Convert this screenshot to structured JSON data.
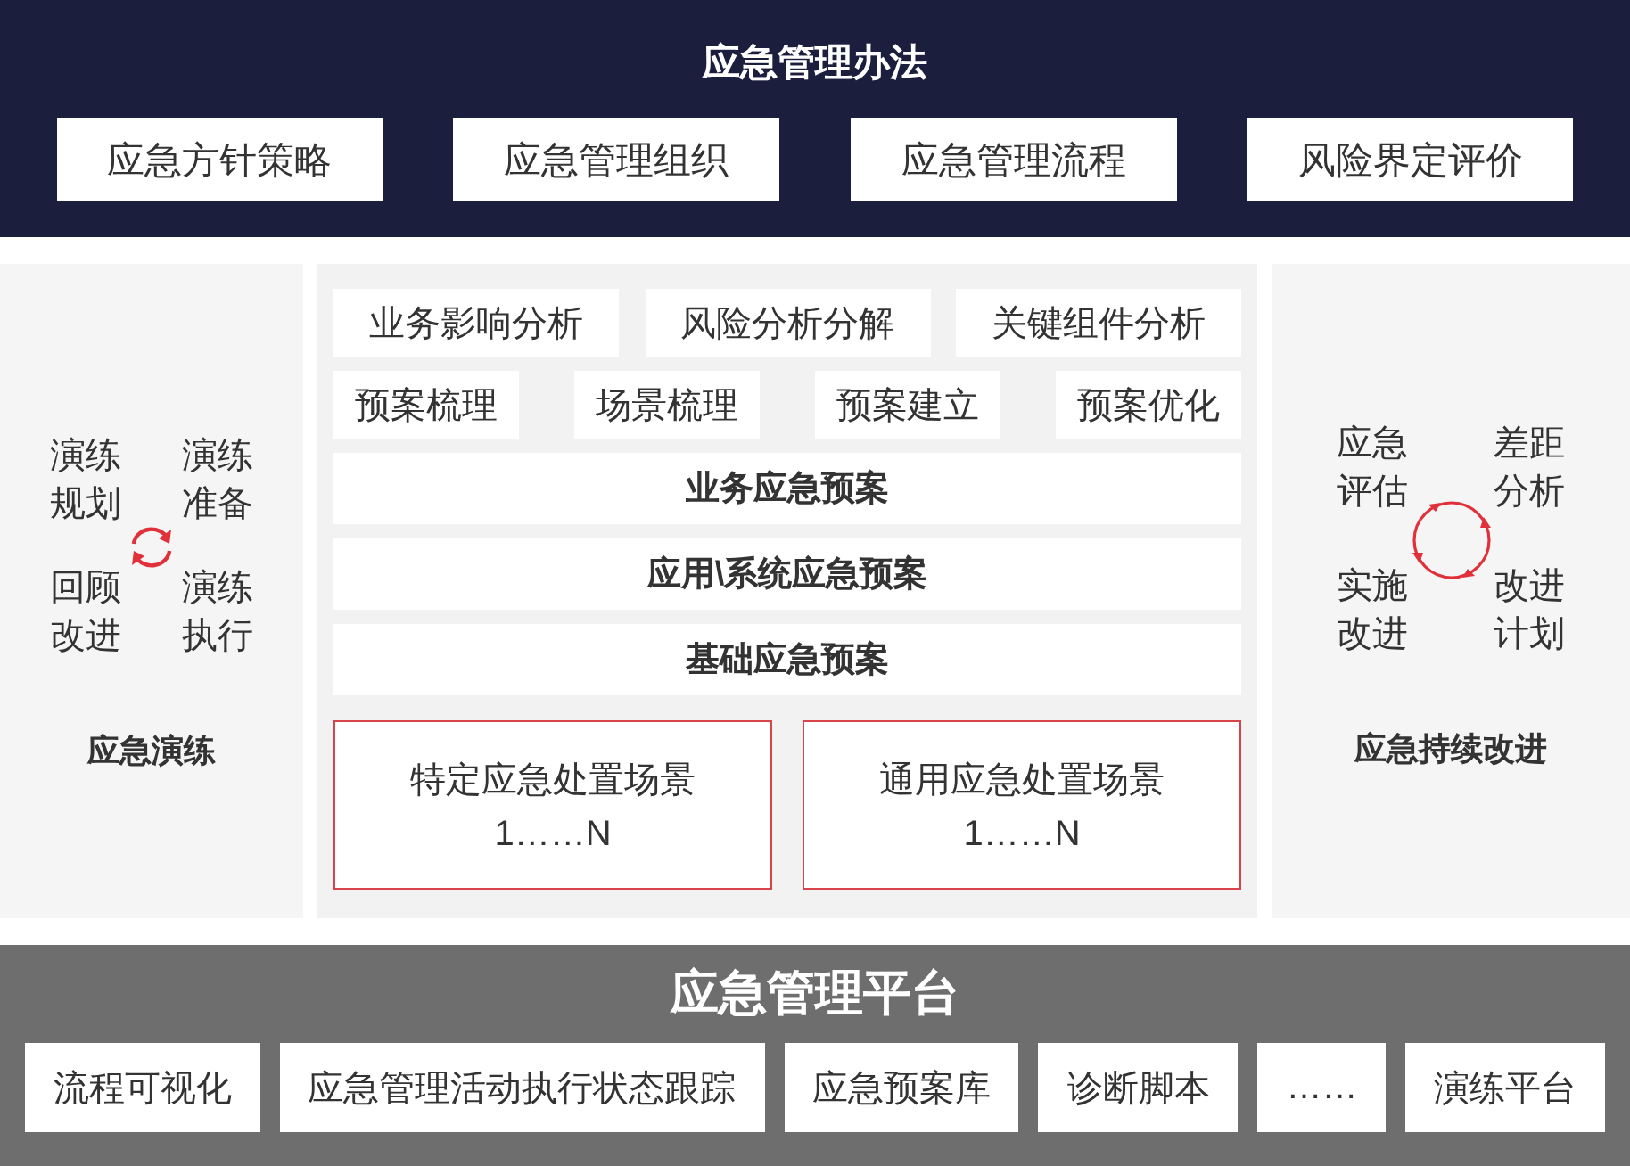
{
  "header": {
    "title": "应急管理办法",
    "items": [
      "应急方针策略",
      "应急管理组织",
      "应急管理流程",
      "风险界定评价"
    ]
  },
  "left_panel": {
    "cycle_labels": [
      "演练规划",
      "演练准备",
      "回顾改进",
      "演练执行"
    ],
    "title": "应急演练"
  },
  "center_panel": {
    "analysis_items": [
      "业务影响分析",
      "风险分析分解",
      "关键组件分析"
    ],
    "plan_items": [
      "预案梳理",
      "场景梳理",
      "预案建立",
      "预案优化"
    ],
    "plan_levels": [
      "业务应急预案",
      "应用\\系统应急预案",
      "基础应急预案"
    ],
    "scenarios": [
      {
        "title": "特定应急处置场景",
        "range": "1……N"
      },
      {
        "title": "通用应急处置场景",
        "range": "1……N"
      }
    ]
  },
  "right_panel": {
    "cycle_labels": [
      "应急评估",
      "差距分析",
      "实施改进",
      "改进计划"
    ],
    "title": "应急持续改进"
  },
  "footer": {
    "title": "应急管理平台",
    "items": [
      "流程可视化",
      "应急管理活动执行状态跟踪",
      "应急预案库",
      "诊断脚本",
      "……",
      "演练平台"
    ]
  }
}
